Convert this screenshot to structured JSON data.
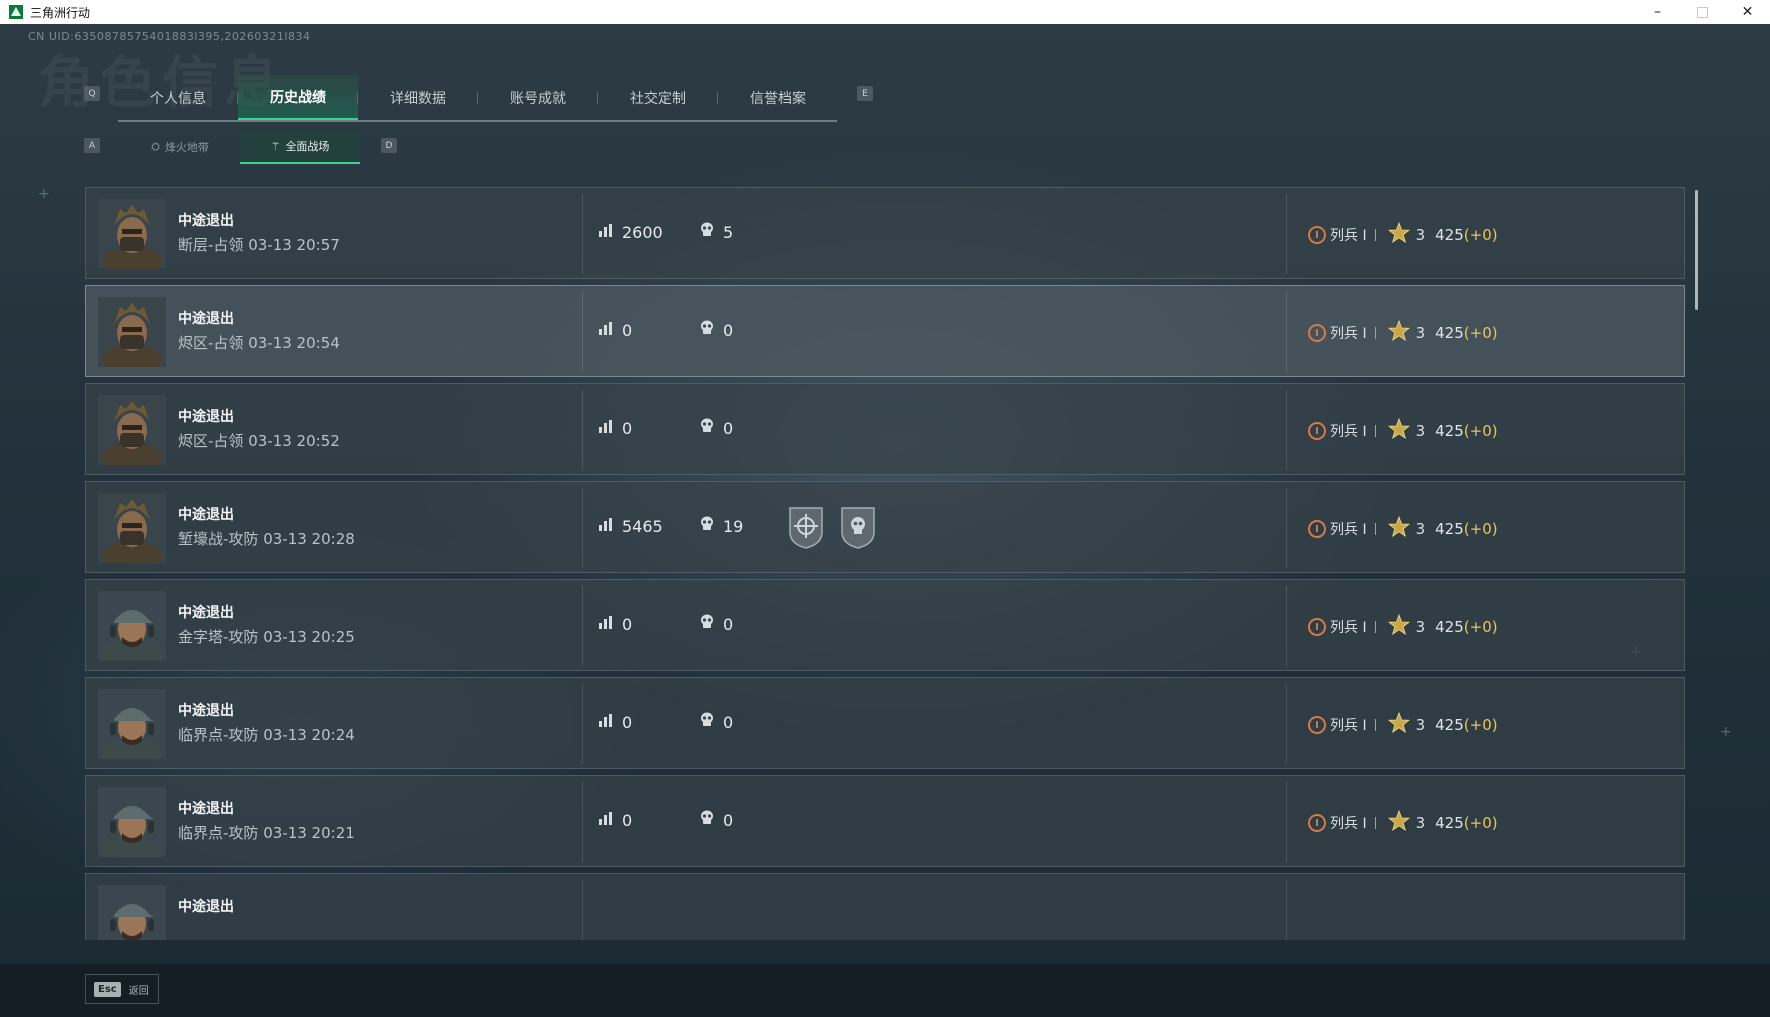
{
  "window": {
    "title": "三角洲行动",
    "minimize": "–",
    "maximize": "□",
    "close": "✕"
  },
  "header": {
    "uid": "CN UID:6350878575401883l395,20260321l834",
    "watermark": "角色信息",
    "key_prev_tab": "Q",
    "key_next_tab": "E",
    "key_prev_sub": "A",
    "key_next_sub": "D"
  },
  "tabs": [
    {
      "label": "个人信息"
    },
    {
      "label": "历史战绩"
    },
    {
      "label": "详细数据"
    },
    {
      "label": "账号成就"
    },
    {
      "label": "社交定制"
    },
    {
      "label": "信誉档案"
    }
  ],
  "active_tab": "历史战绩",
  "subtabs": [
    {
      "label": "烽火地带",
      "icon": "extraction-icon"
    },
    {
      "label": "全面战场",
      "icon": "warfare-icon"
    }
  ],
  "active_subtab": "全面战场",
  "records": [
    {
      "status": "中途退出",
      "map_mode": "断层-占领",
      "time": "03-13 20:57",
      "score": "2600",
      "kills": "5",
      "rank": "列兵 I",
      "stars": "3",
      "points": "425",
      "delta": "(+0)",
      "avatar": "operator-a",
      "medals": []
    },
    {
      "status": "中途退出",
      "map_mode": "烬区-占领",
      "time": "03-13 20:54",
      "score": "0",
      "kills": "0",
      "rank": "列兵 I",
      "stars": "3",
      "points": "425",
      "delta": "(+0)",
      "avatar": "operator-a",
      "medals": []
    },
    {
      "status": "中途退出",
      "map_mode": "烬区-占领",
      "time": "03-13 20:52",
      "score": "0",
      "kills": "0",
      "rank": "列兵 I",
      "stars": "3",
      "points": "425",
      "delta": "(+0)",
      "avatar": "operator-a",
      "medals": []
    },
    {
      "status": "中途退出",
      "map_mode": "堑壕战-攻防",
      "time": "03-13 20:28",
      "score": "5465",
      "kills": "19",
      "rank": "列兵 I",
      "stars": "3",
      "points": "425",
      "delta": "(+0)",
      "avatar": "operator-a",
      "medals": [
        "crosshair-medal-icon",
        "skull-medal-icon"
      ]
    },
    {
      "status": "中途退出",
      "map_mode": "金字塔-攻防",
      "time": "03-13 20:25",
      "score": "0",
      "kills": "0",
      "rank": "列兵 I",
      "stars": "3",
      "points": "425",
      "delta": "(+0)",
      "avatar": "operator-b",
      "medals": []
    },
    {
      "status": "中途退出",
      "map_mode": "临界点-攻防",
      "time": "03-13 20:24",
      "score": "0",
      "kills": "0",
      "rank": "列兵 I",
      "stars": "3",
      "points": "425",
      "delta": "(+0)",
      "avatar": "operator-b",
      "medals": []
    },
    {
      "status": "中途退出",
      "map_mode": "临界点-攻防",
      "time": "03-13 20:21",
      "score": "0",
      "kills": "0",
      "rank": "列兵 I",
      "stars": "3",
      "points": "425",
      "delta": "(+0)",
      "avatar": "operator-b",
      "medals": []
    },
    {
      "status": "中途退出",
      "map_mode": "",
      "time": "",
      "score": "",
      "kills": "",
      "rank": "",
      "stars": "",
      "points": "",
      "delta": "",
      "avatar": "operator-b",
      "medals": []
    }
  ],
  "footer": {
    "esc_key": "Esc",
    "esc_label": "返回"
  },
  "colors": {
    "accent": "#39d38f",
    "rank": "#d47a4a",
    "star": "#e7c75c",
    "delta": "#e7c75c"
  }
}
